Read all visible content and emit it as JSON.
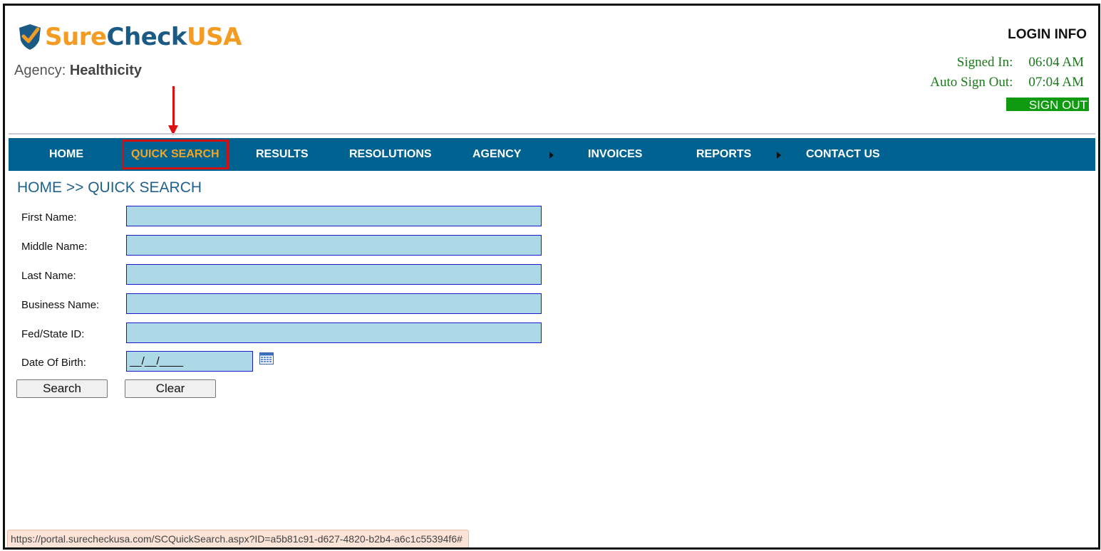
{
  "logo": {
    "part1": "Sure",
    "part2": "Check",
    "part3": "USA"
  },
  "agency": {
    "label": "Agency:",
    "name": "Healthicity"
  },
  "login": {
    "title": "LOGIN INFO",
    "signed_in_label": "Signed In:",
    "signed_in_value": "06:04 AM",
    "auto_sign_out_label": "Auto Sign Out:",
    "auto_sign_out_value": "07:04 AM",
    "sign_out_label": "SIGN OUT"
  },
  "nav": {
    "items": [
      {
        "label": "HOME"
      },
      {
        "label": "QUICK SEARCH"
      },
      {
        "label": "RESULTS"
      },
      {
        "label": "RESOLUTIONS"
      },
      {
        "label": "AGENCY"
      },
      {
        "label": "INVOICES"
      },
      {
        "label": "REPORTS"
      },
      {
        "label": "CONTACT US"
      }
    ]
  },
  "breadcrumb": "HOME >> QUICK SEARCH",
  "form": {
    "first_name_label": "First Name:",
    "first_name_value": "",
    "middle_name_label": "Middle Name:",
    "middle_name_value": "",
    "last_name_label": "Last Name:",
    "last_name_value": "",
    "business_name_label": "Business Name:",
    "business_name_value": "",
    "fed_state_label": "Fed/State ID:",
    "fed_state_value": "",
    "dob_label": "Date Of Birth:",
    "dob_value": "__/__/____",
    "search_label": "Search",
    "clear_label": "Clear"
  },
  "status_bar": "https://portal.surecheckusa.com/SCQuickSearch.aspx?ID=a5b81c91-d627-4820-b2b4-a6c1c55394f6#",
  "colors": {
    "nav_bg": "#006290",
    "active_nav_text": "#f5a524",
    "highlight_border": "#d01010",
    "field_bg": "#add8e6",
    "sign_out_bg": "#109a10",
    "login_text": "#1a7a1a"
  },
  "icons": {
    "logo": "shield-check-icon",
    "calendar": "calendar-icon",
    "annotation": "red-arrow-annotation",
    "submenu": "caret-right-icon"
  }
}
